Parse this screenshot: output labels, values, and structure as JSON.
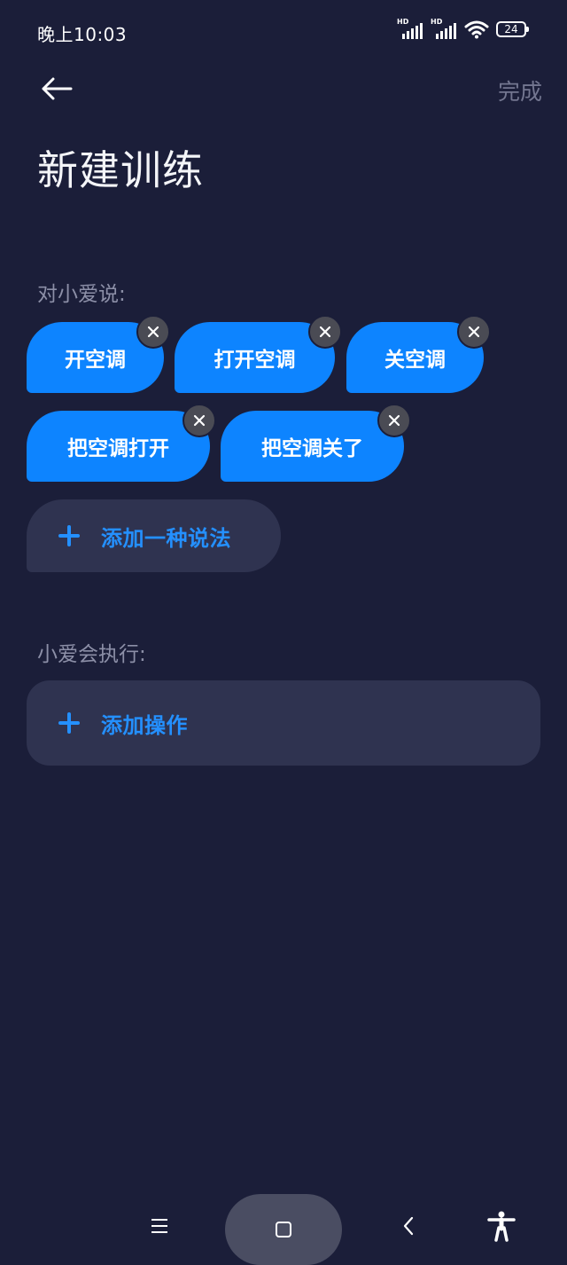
{
  "status_bar": {
    "time": "晚上10:03",
    "signal1_label": "HD",
    "signal2_label": "HD",
    "battery": "24"
  },
  "header": {
    "done_label": "完成",
    "title": "新建训练"
  },
  "say_section": {
    "label": "对小爱说:",
    "phrases": [
      "开空调",
      "打开空调",
      "关空调",
      "把空调打开",
      "把空调关了"
    ],
    "add_label": "添加一种说法"
  },
  "execute_section": {
    "label": "小爱会执行:",
    "add_label": "添加操作"
  },
  "colors": {
    "background": "#1b1e39",
    "chip": "#0d84ff",
    "accent": "#2490ff",
    "card": "#2f3350"
  },
  "icons": {
    "back": "arrow-left-icon",
    "remove": "close-icon",
    "add": "plus-icon",
    "nav_menu": "menu-icon",
    "nav_home": "home-icon",
    "nav_back": "chevron-left-icon",
    "accessibility": "accessibility-icon"
  }
}
